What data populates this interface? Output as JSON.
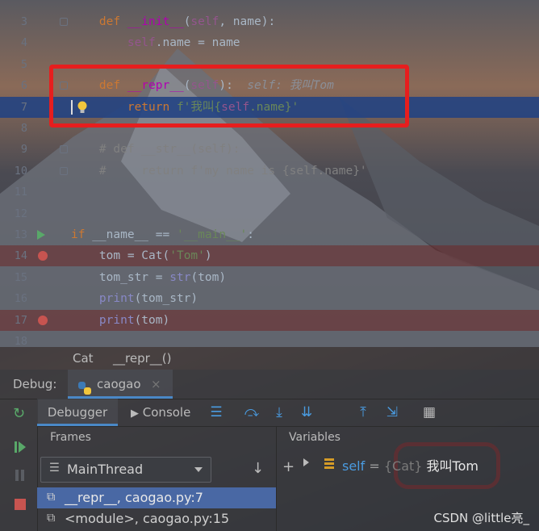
{
  "editor": {
    "lines": [
      {
        "num": "3",
        "parts": [
          [
            "kw",
            "def "
          ],
          [
            "magic",
            "__init__"
          ],
          [
            "",
            "("
          ],
          [
            "selfk",
            "self"
          ],
          [
            "",
            ", name):"
          ]
        ],
        "indent": "    "
      },
      {
        "num": "4",
        "parts": [
          [
            "selfk",
            "self"
          ],
          [
            "",
            ".name = name"
          ]
        ],
        "indent": "        "
      },
      {
        "num": "5",
        "parts": [],
        "indent": ""
      },
      {
        "num": "6",
        "parts": [
          [
            "kw",
            "def "
          ],
          [
            "magic",
            "__repr__"
          ],
          [
            "",
            "("
          ],
          [
            "selfk",
            "self"
          ],
          [
            "",
            "):"
          ],
          [
            "hint",
            "  self: 我叫Tom"
          ]
        ],
        "indent": "    "
      },
      {
        "num": "7",
        "parts": [
          [
            "kw",
            "return "
          ],
          [
            "str",
            "f'我叫{"
          ],
          [
            "selfk",
            "self"
          ],
          [
            "str",
            ".name}'"
          ]
        ],
        "indent": "        "
      },
      {
        "num": "8",
        "parts": [],
        "indent": ""
      },
      {
        "num": "9",
        "parts": [
          [
            "cm",
            "# def __str__(self):"
          ]
        ],
        "indent": "    "
      },
      {
        "num": "10",
        "parts": [
          [
            "cm",
            "#     return f'my name is {self.name}'"
          ]
        ],
        "indent": "    "
      },
      {
        "num": "11",
        "parts": [],
        "indent": ""
      },
      {
        "num": "12",
        "parts": [],
        "indent": ""
      },
      {
        "num": "13",
        "parts": [
          [
            "kw",
            "if "
          ],
          [
            "",
            "__name__ == "
          ],
          [
            "str",
            "'__main__'"
          ],
          [
            "",
            ":"
          ]
        ],
        "indent": ""
      },
      {
        "num": "14",
        "parts": [
          [
            "",
            "tom = Cat("
          ],
          [
            "str",
            "'Tom'"
          ],
          [
            "",
            ")"
          ]
        ],
        "indent": "    "
      },
      {
        "num": "15",
        "parts": [
          [
            "",
            "tom_str = "
          ],
          [
            "bi",
            "str"
          ],
          [
            "",
            "(tom)"
          ]
        ],
        "indent": "    "
      },
      {
        "num": "16",
        "parts": [
          [
            "bi",
            "print"
          ],
          [
            "",
            "(tom_str)"
          ]
        ],
        "indent": "    "
      },
      {
        "num": "17",
        "parts": [
          [
            "bi",
            "print"
          ],
          [
            "",
            "(tom)"
          ]
        ],
        "indent": "    "
      },
      {
        "num": "18",
        "parts": [],
        "indent": ""
      }
    ]
  },
  "breadcrumb": {
    "class_name": "Cat",
    "method": "__repr__()"
  },
  "debug": {
    "label": "Debug:",
    "session_tab": "caogao",
    "close": "×",
    "tabs": {
      "debugger": "Debugger",
      "console": "Console"
    },
    "frames_title": "Frames",
    "variables_title": "Variables",
    "thread_select": "MainThread",
    "frames": [
      {
        "label": "__repr__, caogao.py:7"
      },
      {
        "label": "<module>, caogao.py:15"
      }
    ],
    "variable": {
      "name": "self",
      "eq": " = ",
      "type": "{Cat}",
      "value": " 我叫Tom"
    }
  },
  "watermark": "CSDN @little亮_",
  "colors": {
    "highlight_box": "#e61e1e",
    "exec_line": "#214283",
    "breakpoint": "#c75450"
  }
}
